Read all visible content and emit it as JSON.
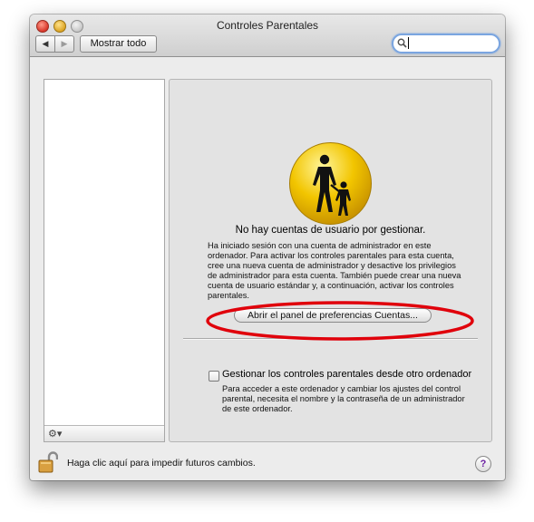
{
  "window": {
    "title": "Controles Parentales"
  },
  "toolbar": {
    "back_icon": "◀",
    "forward_icon": "▶",
    "show_all_label": "Mostrar todo",
    "search_icon": "magnifier-icon",
    "search_value": ""
  },
  "sidebar": {
    "items": [],
    "action_button": "⚙▾"
  },
  "content": {
    "heading": "No hay cuentas de usuario por gestionar.",
    "info_text": "Ha iniciado sesión con una cuenta de administrador en este ordenador. Para activar los controles parentales para esta cuenta, cree una nueva cuenta de administrador y desactive los privilegios de administrador para esta cuenta. También puede crear una nueva cuenta de usuario estándar y, a continuación, activar los controles parentales.",
    "open_accounts_button": "Abrir el panel de preferencias Cuentas...",
    "remote_checkbox_label": "Gestionar los controles parentales desde otro ordenador",
    "remote_checkbox_checked": false,
    "remote_text": "Para acceder a este ordenador y cambiar los ajustes del control parental, necesita el nombre y la contraseña de un administrador de este ordenador."
  },
  "footer": {
    "lock_text": "Haga clic aquí para impedir futuros cambios.",
    "help_label": "?"
  },
  "colors": {
    "annotation_ellipse": "#e0000b",
    "icon_yellow": "#f2c500",
    "search_focus": "#7aa5e0"
  }
}
